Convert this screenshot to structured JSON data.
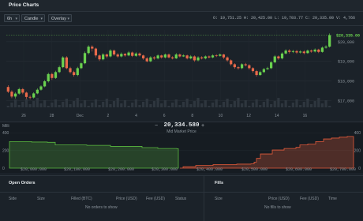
{
  "app": {
    "title": "Price Charts"
  },
  "toolbar": {
    "interval": "6h",
    "chart_type": "Candle",
    "overlay": "Overlay",
    "ohlc": "O: 19,751.25  H: 20,425.00  L: 19,703.77  C: 20,335.00  V: 4,766"
  },
  "chart_data": {
    "type": "candlestick",
    "y_ticks": [
      "$20,000",
      "$19,000",
      "$18,000",
      "$17,000"
    ],
    "y_tick_values": [
      20000,
      19000,
      18000,
      17000
    ],
    "ylim": [
      16650,
      20600
    ],
    "x_ticks": [
      "26",
      "28",
      "Dec",
      "2",
      "4",
      "6",
      "8",
      "10",
      "12",
      "14",
      "16"
    ],
    "last_price_label": "$20,335.00",
    "candles": [
      [
        17690,
        17450,
        17780,
        17380
      ],
      [
        17450,
        17200,
        17520,
        17120
      ],
      [
        17200,
        17350,
        17420,
        17100
      ],
      [
        17350,
        17580,
        17650,
        17300
      ],
      [
        17580,
        17400,
        17640,
        17320
      ],
      [
        17400,
        17180,
        17450,
        17080
      ],
      [
        17180,
        17150,
        17260,
        17060
      ],
      [
        17150,
        17360,
        17420,
        17100
      ],
      [
        17360,
        17550,
        17620,
        17320
      ],
      [
        17550,
        17720,
        17780,
        17500
      ],
      [
        17720,
        17980,
        18050,
        17680
      ],
      [
        17980,
        18350,
        18420,
        17920
      ],
      [
        18350,
        18150,
        18420,
        18050
      ],
      [
        18150,
        18450,
        18520,
        18100
      ],
      [
        18450,
        18700,
        18780,
        18400
      ],
      [
        18700,
        19200,
        19260,
        18650
      ],
      [
        19200,
        18650,
        19260,
        18600
      ],
      [
        18650,
        18450,
        18720,
        18380
      ],
      [
        18450,
        18300,
        18520,
        18220
      ],
      [
        18300,
        18650,
        18720,
        18240
      ],
      [
        18650,
        18900,
        18960,
        18600
      ],
      [
        18900,
        19420,
        19500,
        18850
      ],
      [
        19420,
        19750,
        19820,
        19350
      ],
      [
        19750,
        19650,
        19820,
        19500
      ],
      [
        19650,
        19300,
        19700,
        19200
      ],
      [
        19300,
        19100,
        19360,
        19020
      ],
      [
        19100,
        19350,
        19420,
        19050
      ],
      [
        19350,
        19250,
        19400,
        19160
      ],
      [
        19250,
        19550,
        19620,
        19200
      ],
      [
        19550,
        19350,
        19600,
        19280
      ],
      [
        19350,
        19250,
        19420,
        19180
      ],
      [
        19250,
        19380,
        19450,
        19200
      ],
      [
        19380,
        19300,
        19420,
        19240
      ],
      [
        19300,
        19450,
        19520,
        19260
      ],
      [
        19450,
        19280,
        19500,
        19220
      ],
      [
        19280,
        19400,
        19460,
        19230
      ],
      [
        19400,
        19300,
        19450,
        19250
      ],
      [
        19300,
        19150,
        19340,
        19080
      ],
      [
        19150,
        19000,
        19220,
        18950
      ],
      [
        19000,
        19200,
        19260,
        18960
      ],
      [
        19200,
        19150,
        19260,
        19080
      ],
      [
        19150,
        19300,
        19360,
        19100
      ],
      [
        19300,
        19200,
        19340,
        19140
      ],
      [
        19200,
        19350,
        19400,
        19150
      ],
      [
        19350,
        19200,
        19400,
        19150
      ],
      [
        19200,
        19150,
        19260,
        19100
      ],
      [
        19150,
        19350,
        19420,
        19120
      ],
      [
        19350,
        19250,
        19400,
        19200
      ],
      [
        19250,
        19300,
        19360,
        19220
      ],
      [
        19300,
        19150,
        19340,
        19100
      ],
      [
        19150,
        19250,
        19320,
        19100
      ],
      [
        19250,
        19050,
        19300,
        18980
      ],
      [
        19050,
        19200,
        19260,
        19000
      ],
      [
        19200,
        19150,
        19260,
        19100
      ],
      [
        19150,
        19250,
        19300,
        19100
      ],
      [
        19250,
        19200,
        19300,
        19150
      ],
      [
        19200,
        19300,
        19360,
        19160
      ],
      [
        19300,
        19280,
        19360,
        19220
      ],
      [
        19280,
        19350,
        19400,
        19240
      ],
      [
        19350,
        19200,
        19380,
        19120
      ],
      [
        19200,
        19050,
        19250,
        18980
      ],
      [
        19050,
        18850,
        19100,
        18780
      ],
      [
        18850,
        18700,
        18900,
        18620
      ],
      [
        18700,
        18650,
        18760,
        18580
      ],
      [
        18650,
        18850,
        18900,
        18600
      ],
      [
        18850,
        18800,
        18920,
        18740
      ],
      [
        18800,
        18650,
        18850,
        18580
      ],
      [
        18650,
        18500,
        18700,
        18420
      ],
      [
        18500,
        18300,
        18560,
        18220
      ],
      [
        18300,
        18450,
        18520,
        18260
      ],
      [
        18450,
        18600,
        18660,
        18400
      ],
      [
        18600,
        18650,
        18720,
        18560
      ],
      [
        18650,
        18950,
        19020,
        18600
      ],
      [
        18950,
        19250,
        19320,
        18900
      ],
      [
        19250,
        19150,
        19300,
        19080
      ],
      [
        19150,
        19400,
        19460,
        19100
      ],
      [
        19400,
        19550,
        19620,
        19350
      ],
      [
        19550,
        19480,
        19620,
        19400
      ],
      [
        19480,
        19520,
        19580,
        19420
      ],
      [
        19520,
        19450,
        19580,
        19380
      ],
      [
        19450,
        19500,
        19560,
        19400
      ],
      [
        19500,
        19420,
        19560,
        19360
      ],
      [
        19420,
        19550,
        19600,
        19380
      ],
      [
        19550,
        19500,
        19600,
        19440
      ],
      [
        19500,
        19600,
        19660,
        19450
      ],
      [
        19600,
        19480,
        19640,
        19420
      ],
      [
        19480,
        19700,
        19760,
        19440
      ],
      [
        19700,
        19750,
        19820,
        19650
      ],
      [
        19750,
        20335,
        20425,
        19703
      ]
    ]
  },
  "depth": {
    "mid_price": "20,334.580",
    "mid_label": "Mid Market Price",
    "y_unit": "Milli",
    "y_ticks_left": [
      "400",
      "200",
      "0"
    ],
    "y_ticks_right": [
      "400",
      "200",
      "0"
    ],
    "x_ticks": [
      "$20,000.000",
      "$20,100.000",
      "$20,200.000",
      "$20,300.000",
      "$20,400.000",
      "$20,500.000",
      "$20,600.000",
      "$20,700.000"
    ]
  },
  "open_orders": {
    "title": "Open Orders",
    "columns": [
      "Side",
      "Size",
      "Filled (BTC)",
      "Price (USD)",
      "Fee (USD)",
      "Status"
    ],
    "empty": "No orders to show"
  },
  "fills": {
    "title": "Fills",
    "columns": [
      "Size",
      "Price (USD)",
      "Fee (USD)",
      "Time"
    ],
    "empty": "No fills to show"
  },
  "colors": {
    "up": "#6ad14f",
    "down": "#e8694a",
    "bid": "#5ab83f",
    "ask": "#e35a3a"
  }
}
